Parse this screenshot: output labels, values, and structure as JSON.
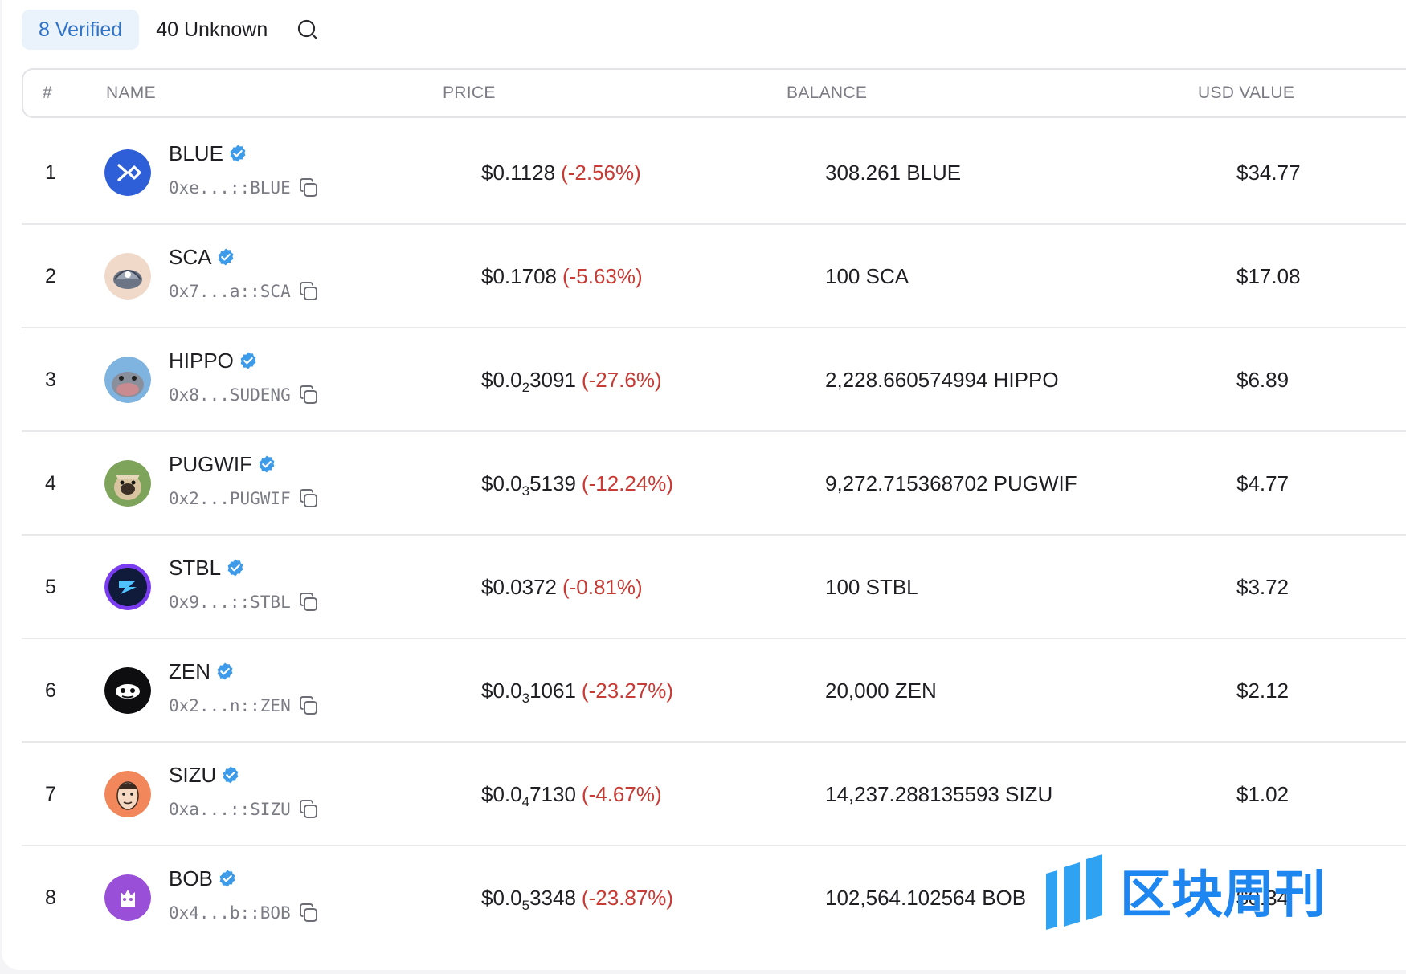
{
  "tabs": {
    "verified": "8 Verified",
    "unknown": "40 Unknown"
  },
  "columns": {
    "index": "#",
    "name": "NAME",
    "price": "PRICE",
    "balance": "BALANCE",
    "usd": "USD VALUE"
  },
  "colors": {
    "accent": "#2f73c9",
    "negative": "#c83a34",
    "verified_badge": "#3d9be9"
  },
  "tokens": [
    {
      "index": "1",
      "symbol": "BLUE",
      "address": "0xe...::BLUE",
      "price_prefix": "$0.1128",
      "price_sub": "",
      "price_rest": "",
      "change": "(-2.56%)",
      "balance": "308.261 BLUE",
      "usd": "$34.77",
      "icon": "blue-token-icon"
    },
    {
      "index": "2",
      "symbol": "SCA",
      "address": "0x7...a::SCA",
      "price_prefix": "$0.1708",
      "price_sub": "",
      "price_rest": "",
      "change": "(-5.63%)",
      "balance": "100 SCA",
      "usd": "$17.08",
      "icon": "sca-token-icon"
    },
    {
      "index": "3",
      "symbol": "HIPPO",
      "address": "0x8...SUDENG",
      "price_prefix": "$0.0",
      "price_sub": "2",
      "price_rest": "3091",
      "change": "(-27.6%)",
      "balance": "2,228.660574994 HIPPO",
      "usd": "$6.89",
      "icon": "hippo-token-icon"
    },
    {
      "index": "4",
      "symbol": "PUGWIF",
      "address": "0x2...PUGWIF",
      "price_prefix": "$0.0",
      "price_sub": "3",
      "price_rest": "5139",
      "change": "(-12.24%)",
      "balance": "9,272.715368702 PUGWIF",
      "usd": "$4.77",
      "icon": "pugwif-token-icon"
    },
    {
      "index": "5",
      "symbol": "STBL",
      "address": "0x9...::STBL",
      "price_prefix": "$0.0372",
      "price_sub": "",
      "price_rest": "",
      "change": "(-0.81%)",
      "balance": "100 STBL",
      "usd": "$3.72",
      "icon": "stbl-token-icon"
    },
    {
      "index": "6",
      "symbol": "ZEN",
      "address": "0x2...n::ZEN",
      "price_prefix": "$0.0",
      "price_sub": "3",
      "price_rest": "1061",
      "change": "(-23.27%)",
      "balance": "20,000 ZEN",
      "usd": "$2.12",
      "icon": "zen-token-icon"
    },
    {
      "index": "7",
      "symbol": "SIZU",
      "address": "0xa...::SIZU",
      "price_prefix": "$0.0",
      "price_sub": "4",
      "price_rest": "7130",
      "change": "(-4.67%)",
      "balance": "14,237.288135593 SIZU",
      "usd": "$1.02",
      "icon": "sizu-token-icon"
    },
    {
      "index": "8",
      "symbol": "BOB",
      "address": "0x4...b::BOB",
      "price_prefix": "$0.0",
      "price_sub": "5",
      "price_rest": "3348",
      "change": "(-23.87%)",
      "balance": "102,564.102564 BOB",
      "usd": "$0.34",
      "icon": "bob-token-icon"
    }
  ],
  "watermark": {
    "text": "区块周刊"
  }
}
